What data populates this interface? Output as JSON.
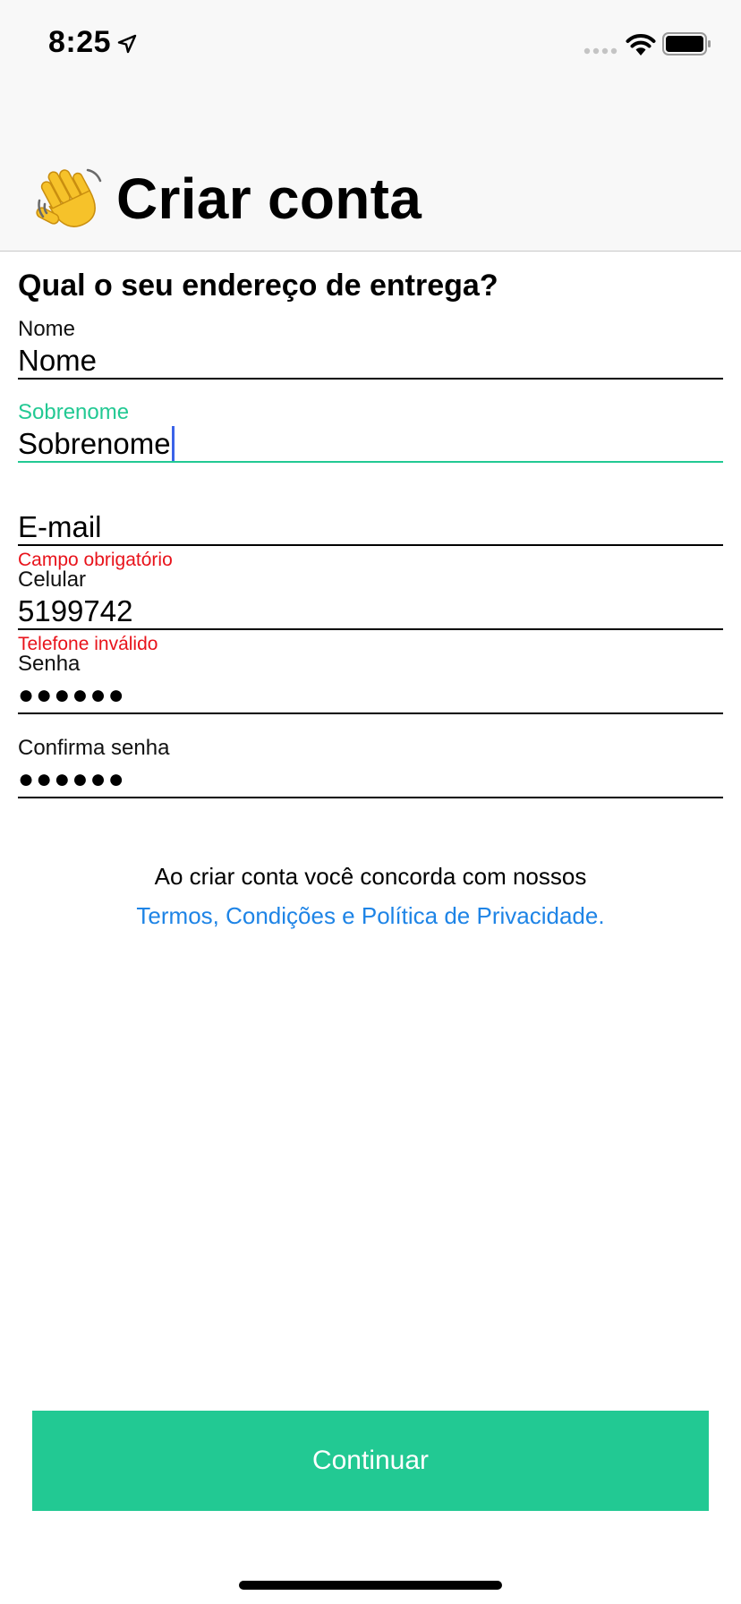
{
  "status_bar": {
    "time": "8:25"
  },
  "header": {
    "title": "Criar conta",
    "icon": "waving-hand-icon"
  },
  "form": {
    "section_title": "Qual o seu endereço de entrega?",
    "fields": {
      "nome": {
        "label": "Nome",
        "value": "Nome"
      },
      "sobrenome": {
        "label": "Sobrenome",
        "value": "Sobrenome"
      },
      "email": {
        "label": "",
        "value": "E-mail",
        "error": "Campo obrigatório"
      },
      "celular": {
        "label": "Celular",
        "value": "5199742",
        "error": "Telefone inválido"
      },
      "senha": {
        "label": "Senha",
        "value": "●●●●●●"
      },
      "confirma_senha": {
        "label": "Confirma senha",
        "value": "●●●●●●"
      }
    }
  },
  "terms": {
    "text": "Ao criar conta você concorda com nossos",
    "link": "Termos, Condições e Política de Privacidade."
  },
  "actions": {
    "continue_label": "Continuar"
  },
  "colors": {
    "accent": "#22c993",
    "error": "#e8131b",
    "link": "#1e84e6",
    "caret": "#3b63e8"
  }
}
